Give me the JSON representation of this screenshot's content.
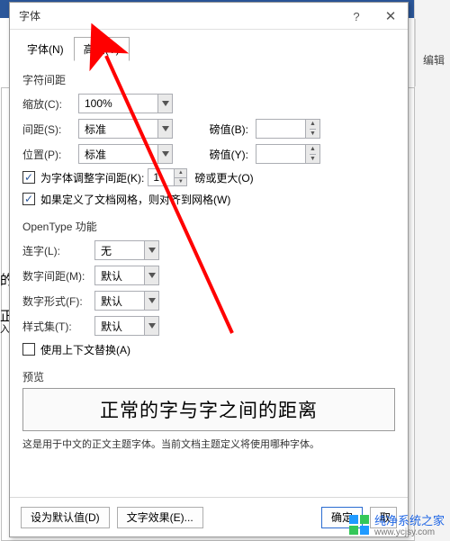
{
  "background": {
    "edit_label": "编辑",
    "side_char1": "的",
    "side_char2": "正",
    "side_char3": "入"
  },
  "dialog": {
    "title": "字体",
    "tabs": {
      "font": "字体(N)",
      "advanced": "高级(V)"
    },
    "spacing_group": "字符间距",
    "scale_label": "缩放(C):",
    "scale_value": "100%",
    "spacing_label": "间距(S):",
    "spacing_value": "标准",
    "position_label": "位置(P):",
    "position_value": "标准",
    "points_label_b": "磅值(B):",
    "points_label_y": "磅值(Y):",
    "kerning_cb": "为字体调整字间距(K):",
    "kerning_value": "1",
    "kerning_unit": "磅或更大(O)",
    "grid_cb": "如果定义了文档网格，则对齐到网格(W)",
    "opentype_group": "OpenType 功能",
    "ligature_label": "连字(L):",
    "ligature_value": "无",
    "numspacing_label": "数字间距(M):",
    "numspacing_value": "默认",
    "numform_label": "数字形式(F):",
    "numform_value": "默认",
    "styleset_label": "样式集(T):",
    "styleset_value": "默认",
    "contextalt_cb": "使用上下文替换(A)",
    "preview_label": "预览",
    "preview_text": "正常的字与字之间的距离",
    "preview_hint": "这是用于中文的正文主题字体。当前文档主题定义将使用哪种字体。",
    "btn_default": "设为默认值(D)",
    "btn_texteffect": "文字效果(E)...",
    "btn_ok": "确定",
    "btn_cancel": "取"
  },
  "watermark": {
    "name": "纯净系统之家",
    "url": "www.ycjsy.com"
  }
}
